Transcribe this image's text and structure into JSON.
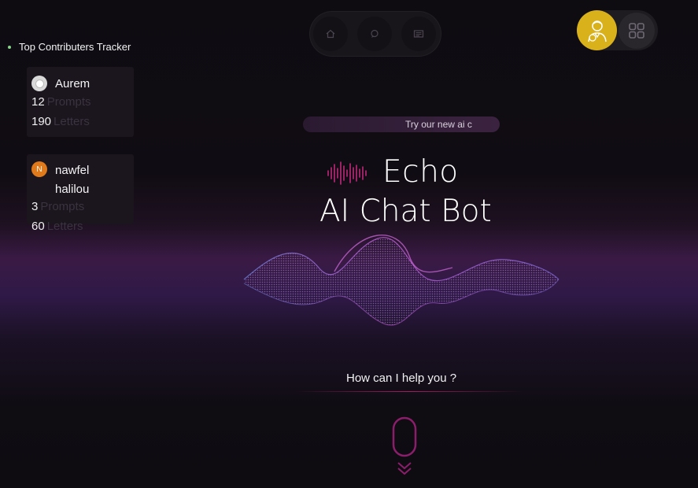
{
  "tracker": {
    "title": "Top Contributers Tracker",
    "contributors": [
      {
        "name": "Aurem",
        "prompts_count": "12",
        "prompts_label": "Prompts",
        "letters_count": "190",
        "letters_label": "Letters"
      },
      {
        "name_line1": "nawfel",
        "name_line2": "halilou",
        "initial": "N",
        "prompts_count": "3",
        "prompts_label": "Prompts",
        "letters_count": "60",
        "letters_label": "Letters"
      }
    ]
  },
  "nav": {
    "icons": [
      "home-icon",
      "chat-icon",
      "news-icon"
    ]
  },
  "user": {
    "avatar_icon": "user-support-icon",
    "menu_icon": "grid-icon"
  },
  "banner": {
    "text": "Try our new ai c"
  },
  "hero": {
    "title": "Echo",
    "subtitle": "AI Chat Bot"
  },
  "prompt": {
    "question": "How can I help you ?"
  },
  "colors": {
    "accent": "#c0287a",
    "avatar_gold": "#d9b11a",
    "wave_purple": "#8a4bd0"
  }
}
